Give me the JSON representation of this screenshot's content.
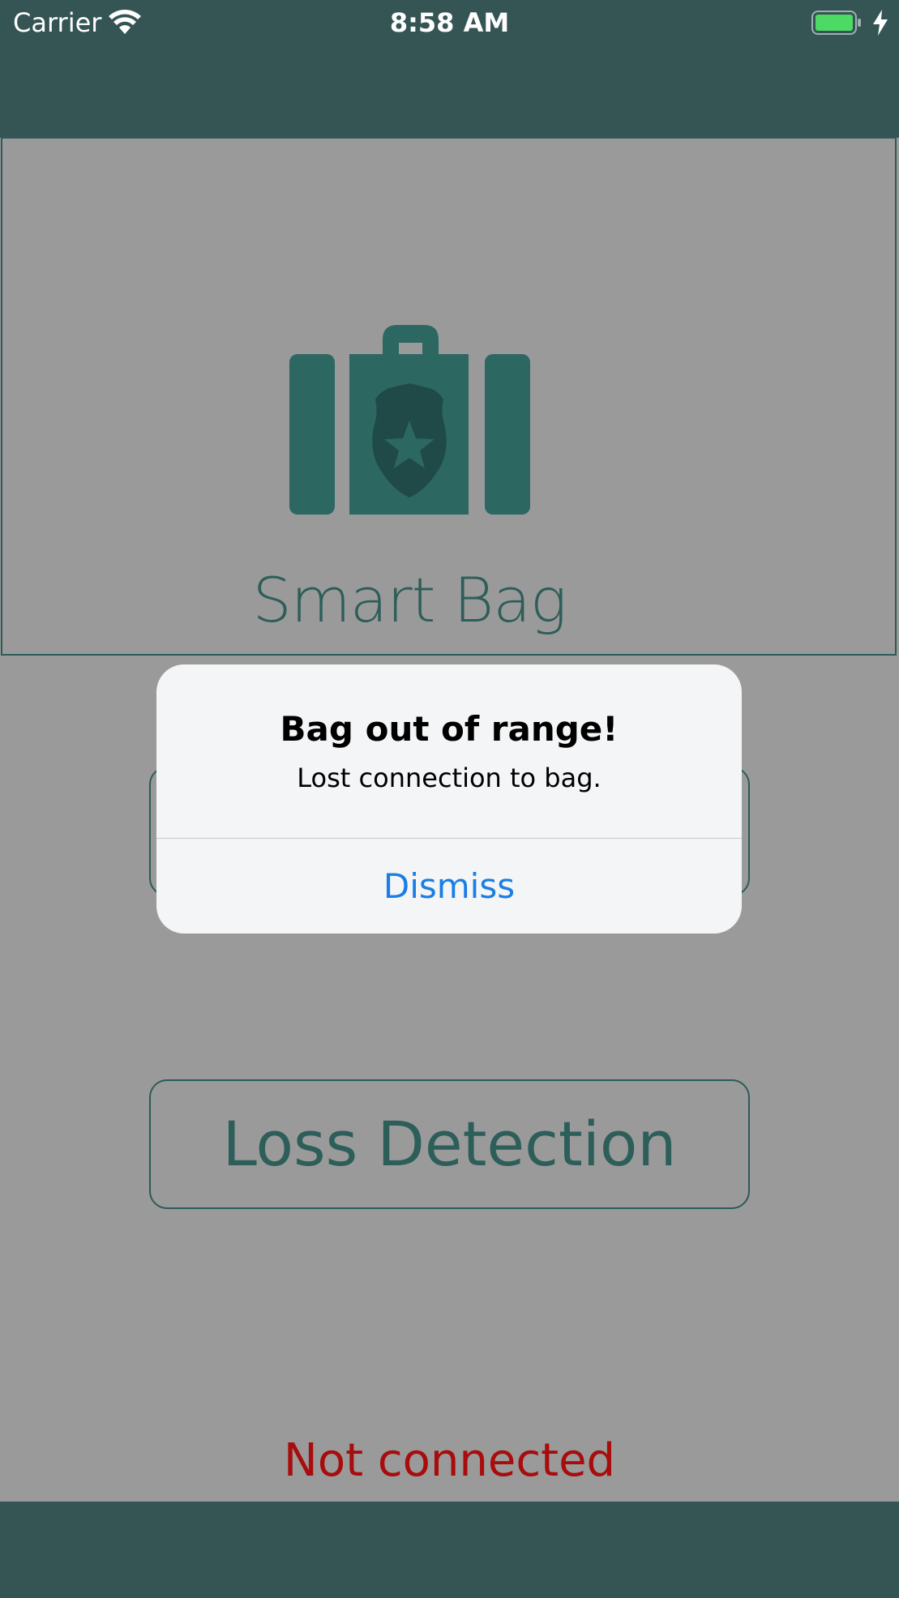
{
  "status_bar": {
    "carrier": "Carrier",
    "time": "8:58 AM",
    "icons": [
      "wifi-icon",
      "battery-icon",
      "charging-bolt-icon"
    ]
  },
  "app": {
    "name": "Smart Bag",
    "logo_icon": "briefcase-shield-star-icon"
  },
  "main": {
    "loss_detection_label": "Loss Detection",
    "connection_status": "Not connected"
  },
  "alert": {
    "title": "Bag out of range!",
    "message": "Lost connection to bag.",
    "action_label": "Dismiss"
  },
  "colors": {
    "bar_background": "#355454",
    "accent": "#2d5e59",
    "status_error": "#a80c0c",
    "alert_action": "#1a7ee6",
    "battery_fill": "#4cd964"
  }
}
